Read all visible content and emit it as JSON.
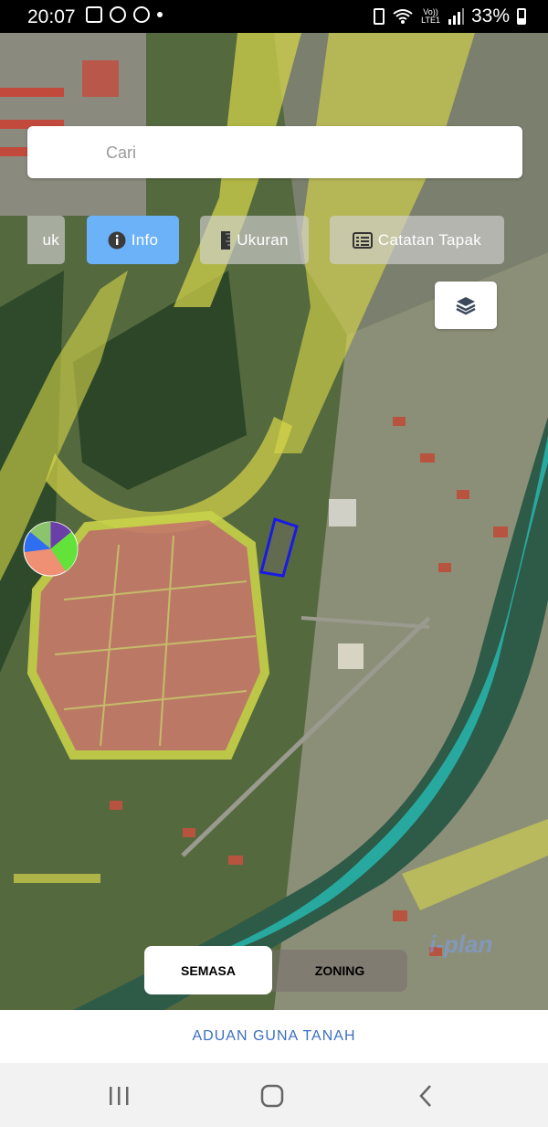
{
  "status_bar": {
    "time": "20:07",
    "network": "LTE1",
    "volte": "Vo))",
    "battery": "33%"
  },
  "search": {
    "placeholder": "Cari",
    "value": ""
  },
  "tools": [
    {
      "label": "uk",
      "icon": "point-icon",
      "active": false
    },
    {
      "label": "Info",
      "icon": "info-icon",
      "active": true
    },
    {
      "label": "Ukuran",
      "icon": "ruler-icon",
      "active": false
    },
    {
      "label": "Catatan Tapak",
      "icon": "notes-icon",
      "active": false
    }
  ],
  "layers_button": {
    "icon": "layers-icon"
  },
  "view_toggle": {
    "semasa": "SEMASA",
    "zoning": "ZONING",
    "selected": "SEMASA"
  },
  "watermark": "i-plan",
  "footer": {
    "link": "ADUAN GUNA TANAH"
  },
  "colors": {
    "active_tool": "#6cb2f8",
    "link": "#3c6fbf",
    "selection": "#1a1ae6",
    "zoning_yellow": "#e4e44a",
    "river_cyan": "#27b7b0"
  },
  "nav_bar": {
    "recents_icon": "recents-icon",
    "home_icon": "home-icon",
    "back_icon": "back-icon"
  }
}
